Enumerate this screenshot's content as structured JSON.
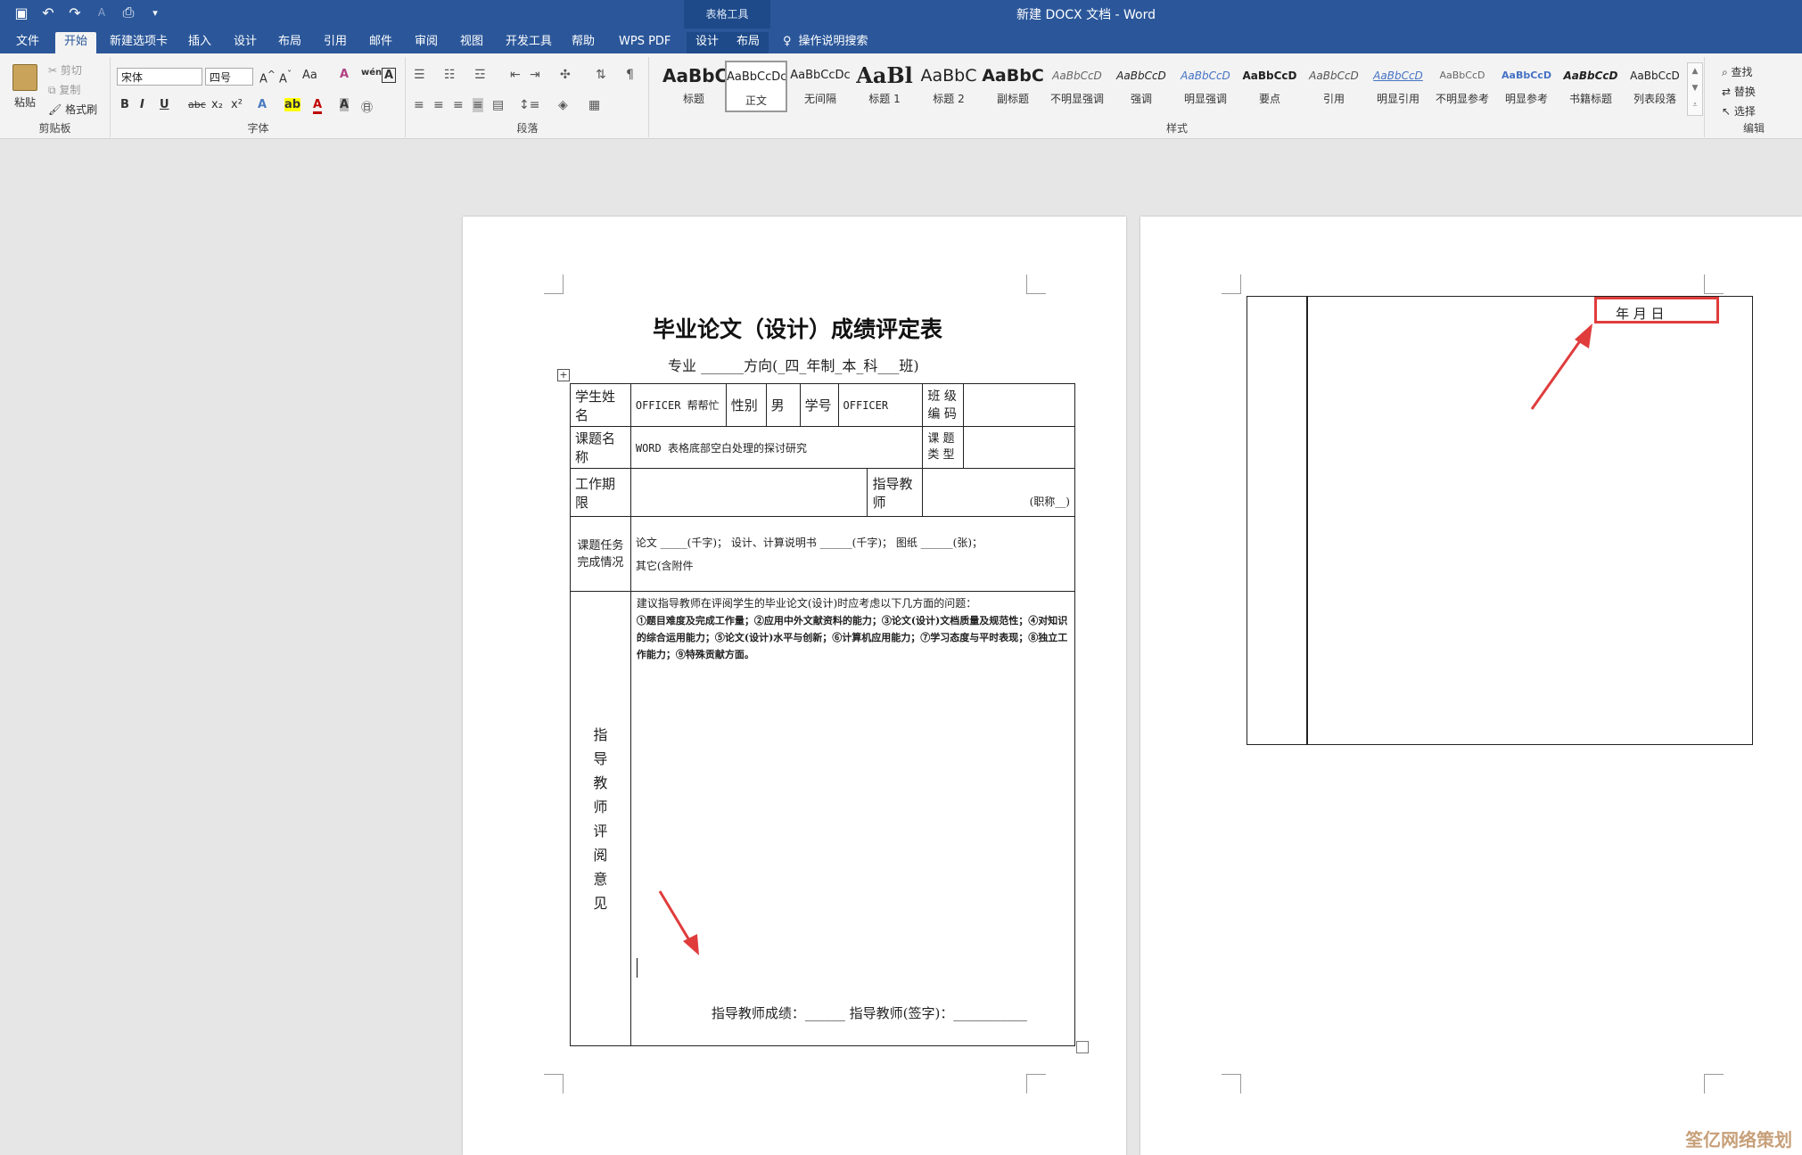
{
  "titlebar": {
    "context_tool": "表格工具",
    "title": "新建 DOCX 文档 - Word"
  },
  "tabs": [
    "文件",
    "开始",
    "新建选项卡",
    "插入",
    "设计",
    "布局",
    "引用",
    "邮件",
    "审阅",
    "视图",
    "开发工具",
    "帮助",
    "WPS PDF",
    "设计",
    "布局"
  ],
  "search_label": "操作说明搜索",
  "ribbon": {
    "clipboard": {
      "paste": "粘贴",
      "cut": "剪切",
      "copy": "复制",
      "format_painter": "格式刷",
      "label": "剪贴板"
    },
    "font": {
      "font_name": "宋体",
      "font_size": "四号",
      "bold": "B",
      "italic": "I",
      "underline": "U",
      "strike": "abc",
      "sub": "x₂",
      "sup": "x²",
      "case": "Aa",
      "label": "字体"
    },
    "paragraph": {
      "label": "段落"
    },
    "styles": {
      "label": "样式",
      "items": [
        {
          "sample": "AaBbC",
          "name": "标题"
        },
        {
          "sample": "AaBbCcDc",
          "name": "正文"
        },
        {
          "sample": "AaBbCcDc",
          "name": "无间隔"
        },
        {
          "sample": "AaBl",
          "name": "标题 1"
        },
        {
          "sample": "AaBbC",
          "name": "标题 2"
        },
        {
          "sample": "AaBbC",
          "name": "副标题"
        },
        {
          "sample": "AaBbCcD",
          "name": "不明显强调"
        },
        {
          "sample": "AaBbCcD",
          "name": "强调"
        },
        {
          "sample": "AaBbCcD",
          "name": "明显强调"
        },
        {
          "sample": "AaBbCcD",
          "name": "要点"
        },
        {
          "sample": "AaBbCcD",
          "name": "引用"
        },
        {
          "sample": "AaBbCcD",
          "name": "明显引用"
        },
        {
          "sample": "AaBbCcD",
          "name": "不明显参考"
        },
        {
          "sample": "AaBbCcD",
          "name": "明显参考"
        },
        {
          "sample": "AaBbCcD",
          "name": "书籍标题"
        },
        {
          "sample": "AaBbCcD",
          "name": "列表段落"
        }
      ]
    },
    "editing": {
      "find": "查找",
      "replace": "替换",
      "select": "选择",
      "label": "编辑"
    }
  },
  "document": {
    "heading": "毕业论文（设计）成绩评定表",
    "subline": "专业 ______方向(_四_年制_本_科___班)",
    "row1": {
      "name_label": "学生姓名",
      "name_value": "OFFICER 帮帮忙",
      "gender_label": "性别",
      "gender_value": "男",
      "id_label": "学号",
      "id_value": "OFFICER",
      "class_label": "班 级 编 码"
    },
    "row2": {
      "topic_label": "课题名称",
      "topic_value": "WORD 表格底部空白处理的探讨研究",
      "type_label": "课 题 类 型"
    },
    "row3": {
      "period_label": "工作期限",
      "advisor_label": "指导教师",
      "title_value": "(职称__)"
    },
    "row4": {
      "label": "课题任务完成情况",
      "line1": "论文 _____(千字)；    设计、计算说明书 ______(千字)；    图纸 ______(张)；",
      "line2": "其它(含附件"
    },
    "row5": {
      "label": "指导教师评阅意见",
      "intro": "建议指导教师在评阅学生的毕业论文(设计)时应考虑以下几方面的问题：",
      "criteria": "①题目难度及完成工作量；②应用中外文献资料的能力；③论文(设计)文档质量及规范性；④对知识的综合运用能力；⑤论文(设计)水平与创新；⑥计算机应用能力；⑦学习态度与平时表现；⑧独立工作能力；⑨特殊贡献方面。",
      "footer": "指导教师成绩：______    指导教师(签字)：___________"
    },
    "page2_date": "年    月    日"
  },
  "watermark": "筌亿网络策划"
}
